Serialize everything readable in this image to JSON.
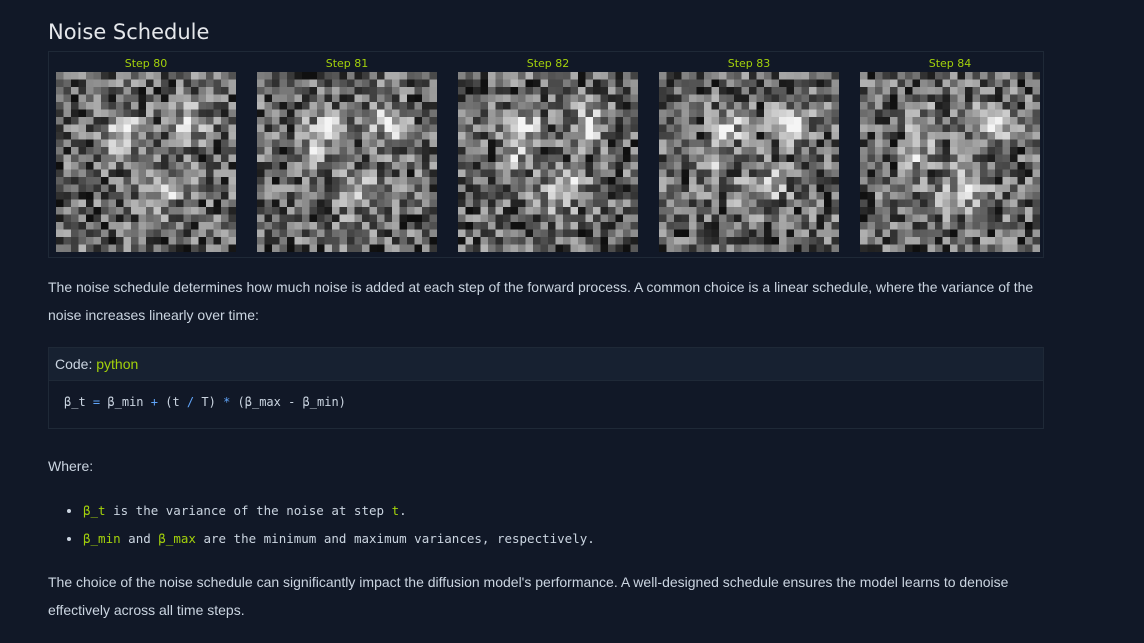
{
  "section": {
    "title": "Noise Schedule"
  },
  "frames": [
    {
      "label": "Step 80",
      "step": 80
    },
    {
      "label": "Step 81",
      "step": 81
    },
    {
      "label": "Step 82",
      "step": 82
    },
    {
      "label": "Step 83",
      "step": 83
    },
    {
      "label": "Step 84",
      "step": 84
    }
  ],
  "intro": "The noise schedule determines how much noise is added at each step of the forward process. A common choice is a linear schedule, where the variance of the noise increases linearly over time:",
  "code": {
    "header_label": "Code:",
    "language": "python",
    "tokens": [
      "β_t",
      "=",
      "β_min",
      "+",
      "(t",
      "/",
      "T)",
      "*",
      "(β_max - β_min)"
    ]
  },
  "where_label": "Where:",
  "bullets": [
    {
      "term": "β_t",
      "text_a": " is the variance of the noise at step ",
      "term2": "t",
      "text_b": "."
    },
    {
      "term": "β_min",
      "text_a": " and ",
      "term2": "β_max",
      "text_b": " are the minimum and maximum variances, respectively."
    }
  ],
  "outro": "The choice of the noise schedule can significantly impact the diffusion model's performance. A well-designed schedule ensures the model learns to denoise effectively across all time steps.",
  "colors": {
    "accent": "#a3d10b",
    "background": "#111827",
    "operator": "#60a5fa"
  }
}
